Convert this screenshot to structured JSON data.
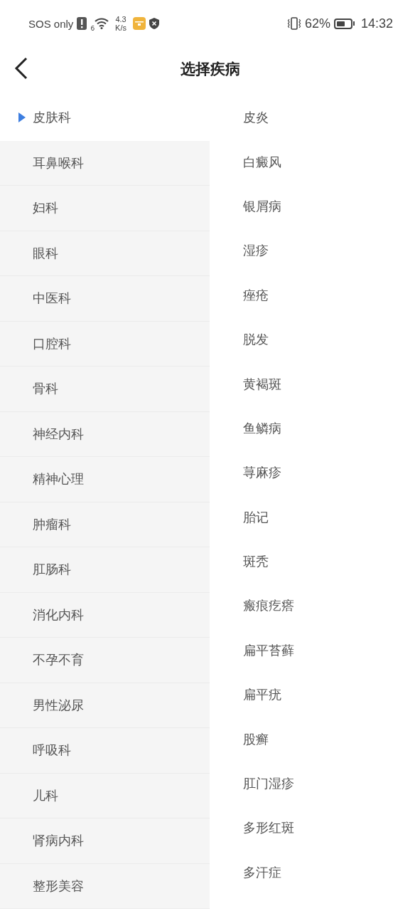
{
  "status_bar": {
    "carrier": "SOS only",
    "network_badge": "6",
    "speed_value": "4.3",
    "speed_unit": "K/s",
    "battery_percent": "62%",
    "time": "14:32"
  },
  "header": {
    "title": "选择疾病"
  },
  "departments": [
    {
      "label": "皮肤科",
      "selected": true
    },
    {
      "label": "耳鼻喉科",
      "selected": false
    },
    {
      "label": "妇科",
      "selected": false
    },
    {
      "label": "眼科",
      "selected": false
    },
    {
      "label": "中医科",
      "selected": false
    },
    {
      "label": "口腔科",
      "selected": false
    },
    {
      "label": "骨科",
      "selected": false
    },
    {
      "label": "神经内科",
      "selected": false
    },
    {
      "label": "精神心理",
      "selected": false
    },
    {
      "label": "肿瘤科",
      "selected": false
    },
    {
      "label": "肛肠科",
      "selected": false
    },
    {
      "label": "消化内科",
      "selected": false
    },
    {
      "label": "不孕不育",
      "selected": false
    },
    {
      "label": "男性泌尿",
      "selected": false
    },
    {
      "label": "呼吸科",
      "selected": false
    },
    {
      "label": "儿科",
      "selected": false
    },
    {
      "label": "肾病内科",
      "selected": false
    },
    {
      "label": "整形美容",
      "selected": false
    }
  ],
  "diseases": [
    "皮炎",
    "白癜风",
    "银屑病",
    "湿疹",
    "痤疮",
    "脱发",
    "黄褐斑",
    "鱼鳞病",
    "荨麻疹",
    "胎记",
    "斑秃",
    "瘢痕疙瘩",
    "扁平苔藓",
    "扁平疣",
    "股癣",
    "肛门湿疹",
    "多形红斑",
    "多汗症"
  ]
}
